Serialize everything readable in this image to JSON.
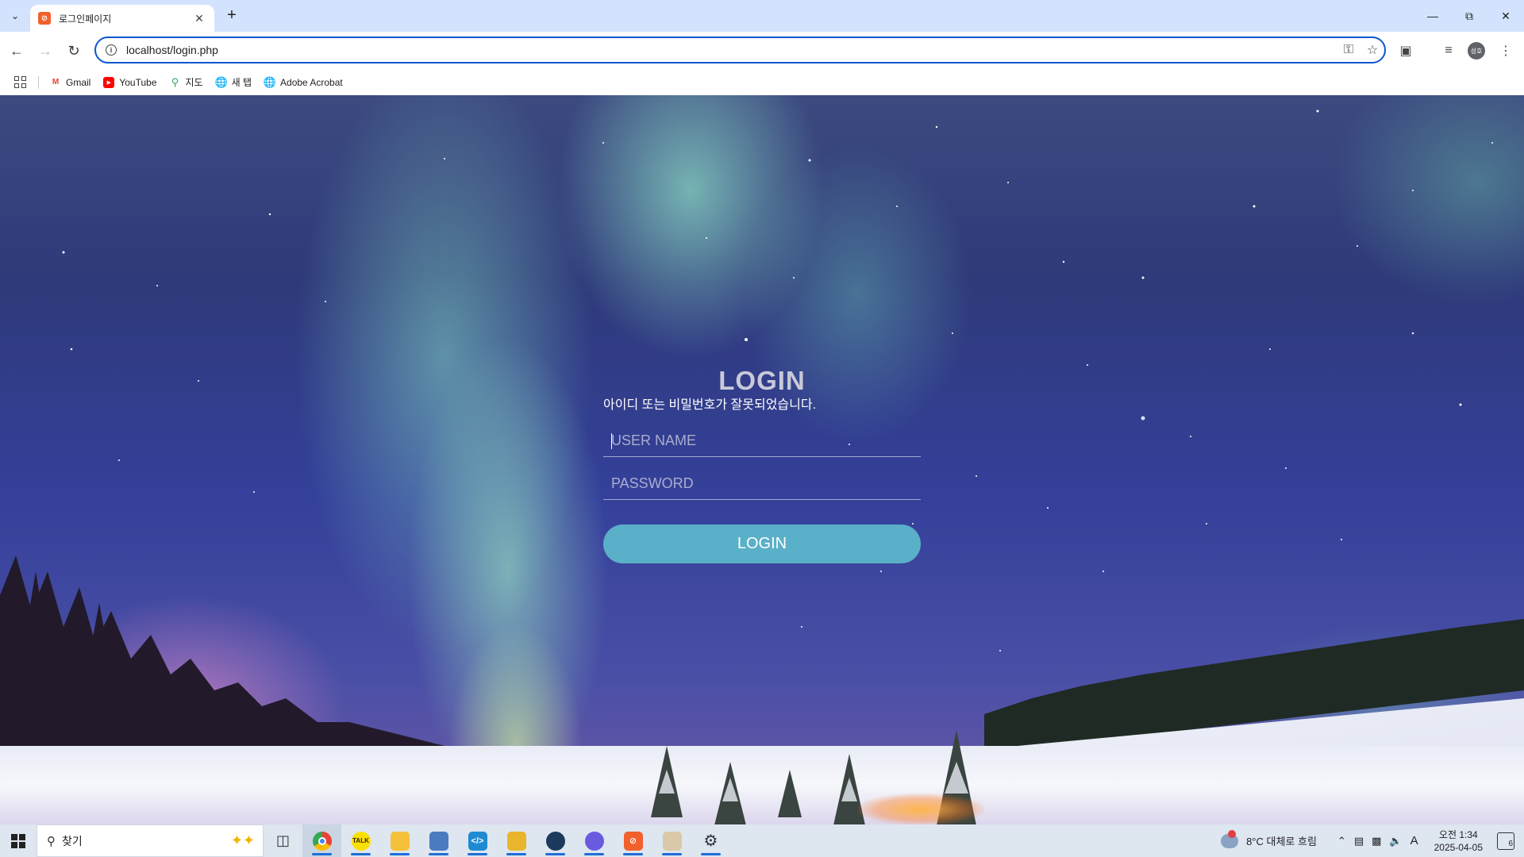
{
  "browser": {
    "tab": {
      "title": "로그인페이지",
      "favicon": "xampp-icon"
    },
    "url": "localhost/login.php",
    "profile_initials": "성호",
    "bookmarks": [
      {
        "label": "Gmail",
        "icon": "gmail-icon",
        "color": "#ea4335"
      },
      {
        "label": "YouTube",
        "icon": "youtube-icon",
        "color": "#ff0000"
      },
      {
        "label": "지도",
        "icon": "maps-icon",
        "color": "#34a853"
      },
      {
        "label": "새 탭",
        "icon": "globe-icon",
        "color": "#444444"
      },
      {
        "label": "Adobe Acrobat",
        "icon": "globe-icon",
        "color": "#444444"
      }
    ]
  },
  "login": {
    "title": "LOGIN",
    "error_message": "아이디 또는 비밀번호가 잘못되었습니다.",
    "username_placeholder": "USER NAME",
    "password_placeholder": "PASSWORD",
    "submit_label": "LOGIN",
    "button_color": "#5ab0c8"
  },
  "taskbar": {
    "search_label": "찾기",
    "weather": "8°C  대체로 흐림",
    "ime_indicator": "A",
    "clock_time": "오전 1:34",
    "clock_date": "2025-04-05",
    "notification_count": "6",
    "apps": [
      "task-view-icon",
      "chrome-icon",
      "kakaotalk-icon",
      "file-explorer-icon",
      "app-icon",
      "vscode-icon",
      "folder-app-icon",
      "app-icon",
      "app-icon",
      "xampp-icon",
      "paint-icon",
      "settings-icon"
    ]
  }
}
